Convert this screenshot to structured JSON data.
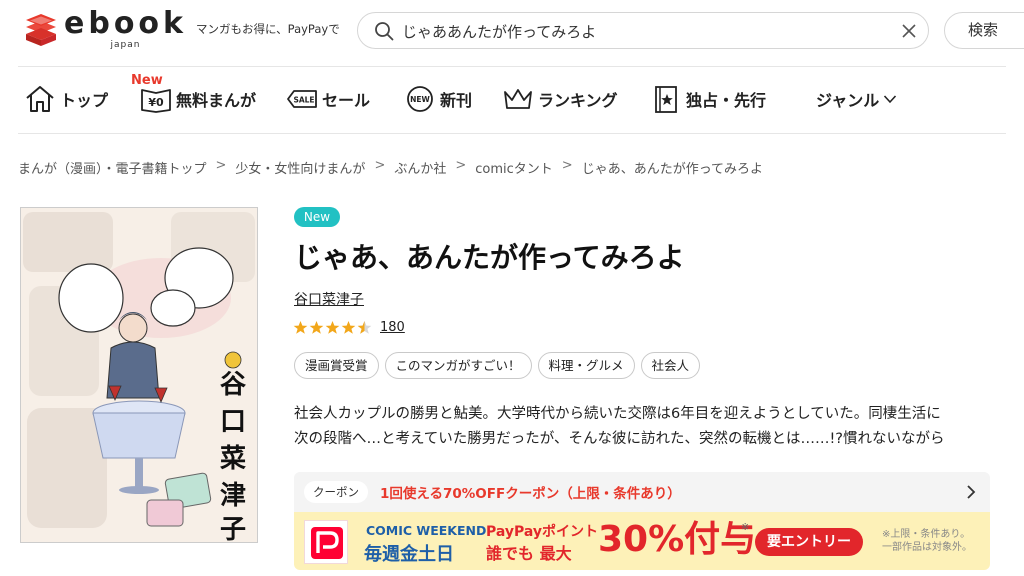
{
  "header": {
    "logo_word": "ebook",
    "logo_sub": "japan",
    "tagline": "マンガもお得に、PayPayで",
    "search": {
      "value": "じゃああんたが作ってみろよ",
      "placeholder": ""
    },
    "search_button": "検索"
  },
  "nav": {
    "new_badge": "New",
    "items": [
      {
        "label": "トップ",
        "icon": "home-icon"
      },
      {
        "label": "無料まんが",
        "icon": "free-book-icon"
      },
      {
        "label": "セール",
        "icon": "sale-tag-icon"
      },
      {
        "label": "新刊",
        "icon": "new-circle-icon"
      },
      {
        "label": "ランキング",
        "icon": "crown-icon"
      },
      {
        "label": "独占・先行",
        "icon": "exclusive-book-icon"
      },
      {
        "label": "ジャンル",
        "icon": "chevron-down-icon"
      }
    ]
  },
  "breadcrumb": [
    "まんが（漫画）・電子書籍トップ",
    "少女・女性向けまんが",
    "ぶんか社",
    "comicタント",
    "じゃあ、あんたが作ってみろよ"
  ],
  "breadcrumb_separator": ">",
  "book": {
    "new_label": "New",
    "title": "じゃあ、あんたが作ってみろよ",
    "author": "谷口菜津子",
    "rating": 4.5,
    "rating_count": "180",
    "tags": [
      "漫画賞受賞",
      "このマンガがすごい！",
      "料理・グルメ",
      "社会人"
    ],
    "description_lines": [
      "社会人カップルの勝男と鮎美。大学時代から続いた交際は6年目を迎えようとしていた。同棲生活に",
      "次の段階へ…と考えていた勝男だったが、そんな彼に訪れた、突然の転機とは……!?慣れないながら"
    ]
  },
  "coupon": {
    "label": "クーポン",
    "text": "1回使える70%OFFクーポン（上限・条件あり）"
  },
  "banner": {
    "line_a1": "COMIC WEEKEND",
    "line_a2": "毎週金土日",
    "line_b1": "PayPayポイント",
    "line_b2": "誰でも 最大",
    "big": "30%付与",
    "mark": "※",
    "entry_button": "要エントリー",
    "note_1": "※上限・条件あり。",
    "note_2": "一部作品は対象外。"
  },
  "colors": {
    "brand_red": "#e8392c",
    "new_pill": "#22c1c3",
    "banner_bg": "#fdf1b8",
    "banner_red": "#e2262b",
    "banner_blue": "#1e5fa8",
    "star": "#f2a71b"
  }
}
